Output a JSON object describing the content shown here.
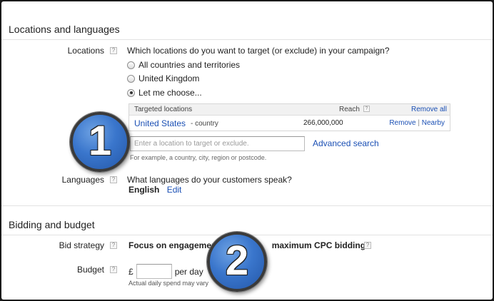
{
  "locations_section": {
    "title": "Locations and languages",
    "locations": {
      "label": "Locations",
      "help": "?",
      "question": "Which locations do you want to target (or exclude) in your campaign?",
      "options": [
        {
          "label": "All countries and territories",
          "checked": false
        },
        {
          "label": "United Kingdom",
          "checked": false
        },
        {
          "label": "Let me choose...",
          "checked": true
        }
      ],
      "table": {
        "col_location": "Targeted locations",
        "col_reach": "Reach",
        "col_help": "?",
        "remove_all": "Remove all",
        "rows": [
          {
            "name": "United States",
            "type": "- country",
            "reach": "266,000,000",
            "remove": "Remove",
            "sep": "|",
            "nearby": "Nearby"
          }
        ]
      },
      "input_placeholder": "Enter a location to target or exclude.",
      "advanced_search": "Advanced search",
      "hint": "For example, a country, city, region or postcode."
    },
    "languages": {
      "label": "Languages",
      "help": "?",
      "question": "What languages do your customers speak?",
      "value": "English",
      "edit": "Edit"
    }
  },
  "bidding_section": {
    "title": "Bidding and budget",
    "bid_strategy": {
      "label": "Bid strategy",
      "help": "?",
      "value": "Focus on engagement                      maximum CPC bidding",
      "value_help": "?"
    },
    "budget": {
      "label": "Budget",
      "help": "?",
      "currency": "£",
      "per_day": "per day",
      "note": "Actual daily spend may vary"
    }
  },
  "badges": [
    {
      "number": "1"
    },
    {
      "number": "2"
    }
  ],
  "colors": {
    "link": "#1a4fb4",
    "badge": "#3a76cc"
  }
}
